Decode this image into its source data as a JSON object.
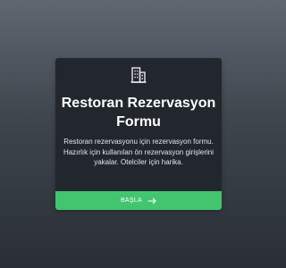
{
  "card": {
    "icon": "building-icon",
    "title": "Restoran Rezervasyon Formu",
    "description": "Restoran rezervasyonu için rezervasyon formu. Hazırlık için kullanılan ön rezervasyon girişlerini yakalar. Otelciler için harika.",
    "cta_label": "BAŞLA",
    "cta_icon": "arrow-right-icon"
  },
  "colors": {
    "card_background": "#22272e",
    "accent": "#43c56f",
    "text": "#ffffff"
  }
}
